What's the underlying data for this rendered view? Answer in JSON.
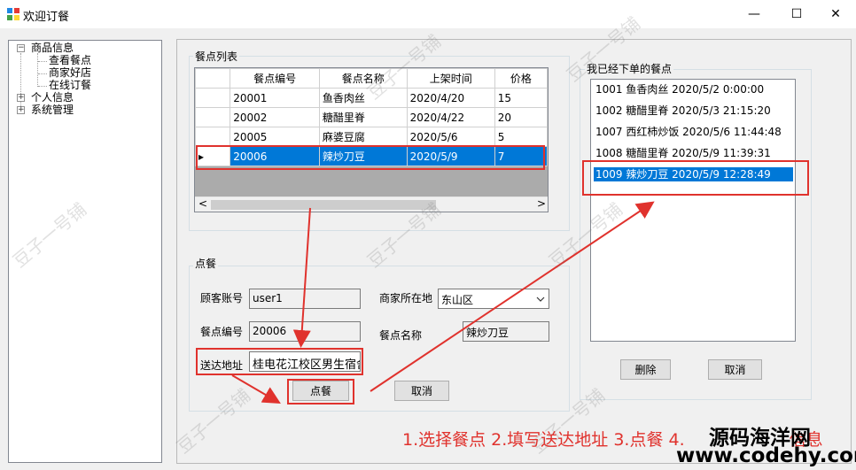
{
  "window": {
    "title": "欢迎订餐",
    "minimize_glyph": "—",
    "maximize_glyph": "☐",
    "close_glyph": "✕"
  },
  "tree": {
    "nodes": [
      {
        "label": "商品信息",
        "expander": "−"
      },
      {
        "label": "查看餐点"
      },
      {
        "label": "商家好店"
      },
      {
        "label": "在线订餐"
      },
      {
        "label": "个人信息",
        "expander": "+"
      },
      {
        "label": "系统管理",
        "expander": "+"
      }
    ]
  },
  "menu_list": {
    "group_title": "餐点列表",
    "columns": [
      "餐点编号",
      "餐点名称",
      "上架时间",
      "价格"
    ],
    "rows": [
      [
        "20001",
        "鱼香肉丝",
        "2020/4/20",
        "15"
      ],
      [
        "20002",
        "糖醋里脊",
        "2020/4/22",
        "20"
      ],
      [
        "20005",
        "麻婆豆腐",
        "2020/5/6",
        "5"
      ],
      [
        "20006",
        "辣炒刀豆",
        "2020/5/9",
        "7"
      ]
    ],
    "selected_row": 3,
    "row_pointer": "▸",
    "scroll_left": "<",
    "scroll_right": ">"
  },
  "order_form": {
    "group_title": "点餐",
    "customer_label": "顾客账号",
    "customer_value": "user1",
    "district_label": "商家所在地",
    "district_value": "东山区",
    "dish_id_label": "餐点编号",
    "dish_id_value": "20006",
    "dish_name_label": "餐点名称",
    "dish_name_value": "辣炒刀豆",
    "address_label": "送达地址",
    "address_value": "桂电花江校区男生宿舍",
    "order_button": "点餐",
    "cancel_button": "取消"
  },
  "my_orders": {
    "group_title": "我已经下单的餐点",
    "items": [
      "1001 鱼香肉丝 2020/5/2 0:00:00",
      "1002 糖醋里脊 2020/5/3 21:15:20",
      "1007 西红柿炒饭 2020/5/6 11:44:48",
      "1008 糖醋里脊 2020/5/9 11:39:31",
      "1009 辣炒刀豆 2020/5/9 12:28:49"
    ],
    "selected_index": 4,
    "delete_button": "删除",
    "cancel_button": "取消"
  },
  "annotation": {
    "caption": "1.选择餐点 2.填写送达地址 3.点餐 4.",
    "caption_tail": "信息",
    "arrow_color": "#e0322d"
  },
  "watermark": {
    "text": "豆子一号铺",
    "brand_cn": "源码海洋网",
    "brand_url": "www.codehy.com"
  }
}
